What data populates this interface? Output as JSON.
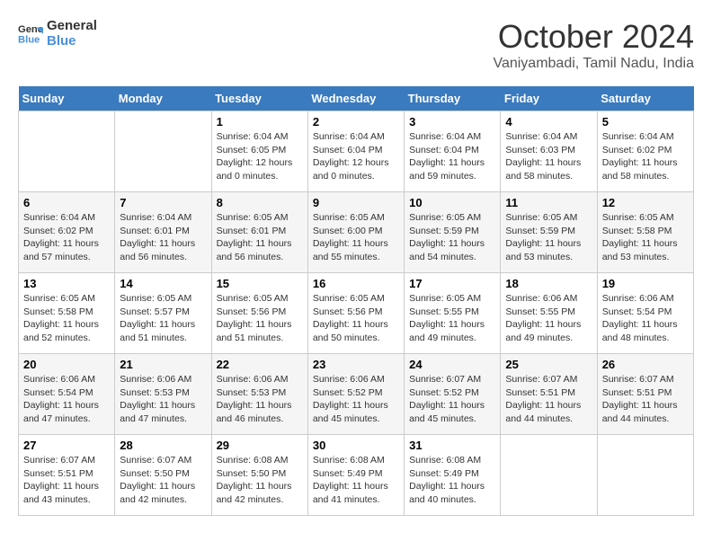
{
  "logo": {
    "line1": "General",
    "line2": "Blue"
  },
  "title": "October 2024",
  "subtitle": "Vaniyambadi, Tamil Nadu, India",
  "headers": [
    "Sunday",
    "Monday",
    "Tuesday",
    "Wednesday",
    "Thursday",
    "Friday",
    "Saturday"
  ],
  "weeks": [
    [
      {
        "day": "",
        "info": ""
      },
      {
        "day": "",
        "info": ""
      },
      {
        "day": "1",
        "info": "Sunrise: 6:04 AM\nSunset: 6:05 PM\nDaylight: 12 hours\nand 0 minutes."
      },
      {
        "day": "2",
        "info": "Sunrise: 6:04 AM\nSunset: 6:04 PM\nDaylight: 12 hours\nand 0 minutes."
      },
      {
        "day": "3",
        "info": "Sunrise: 6:04 AM\nSunset: 6:04 PM\nDaylight: 11 hours\nand 59 minutes."
      },
      {
        "day": "4",
        "info": "Sunrise: 6:04 AM\nSunset: 6:03 PM\nDaylight: 11 hours\nand 58 minutes."
      },
      {
        "day": "5",
        "info": "Sunrise: 6:04 AM\nSunset: 6:02 PM\nDaylight: 11 hours\nand 58 minutes."
      }
    ],
    [
      {
        "day": "6",
        "info": "Sunrise: 6:04 AM\nSunset: 6:02 PM\nDaylight: 11 hours\nand 57 minutes."
      },
      {
        "day": "7",
        "info": "Sunrise: 6:04 AM\nSunset: 6:01 PM\nDaylight: 11 hours\nand 56 minutes."
      },
      {
        "day": "8",
        "info": "Sunrise: 6:05 AM\nSunset: 6:01 PM\nDaylight: 11 hours\nand 56 minutes."
      },
      {
        "day": "9",
        "info": "Sunrise: 6:05 AM\nSunset: 6:00 PM\nDaylight: 11 hours\nand 55 minutes."
      },
      {
        "day": "10",
        "info": "Sunrise: 6:05 AM\nSunset: 5:59 PM\nDaylight: 11 hours\nand 54 minutes."
      },
      {
        "day": "11",
        "info": "Sunrise: 6:05 AM\nSunset: 5:59 PM\nDaylight: 11 hours\nand 53 minutes."
      },
      {
        "day": "12",
        "info": "Sunrise: 6:05 AM\nSunset: 5:58 PM\nDaylight: 11 hours\nand 53 minutes."
      }
    ],
    [
      {
        "day": "13",
        "info": "Sunrise: 6:05 AM\nSunset: 5:58 PM\nDaylight: 11 hours\nand 52 minutes."
      },
      {
        "day": "14",
        "info": "Sunrise: 6:05 AM\nSunset: 5:57 PM\nDaylight: 11 hours\nand 51 minutes."
      },
      {
        "day": "15",
        "info": "Sunrise: 6:05 AM\nSunset: 5:56 PM\nDaylight: 11 hours\nand 51 minutes."
      },
      {
        "day": "16",
        "info": "Sunrise: 6:05 AM\nSunset: 5:56 PM\nDaylight: 11 hours\nand 50 minutes."
      },
      {
        "day": "17",
        "info": "Sunrise: 6:05 AM\nSunset: 5:55 PM\nDaylight: 11 hours\nand 49 minutes."
      },
      {
        "day": "18",
        "info": "Sunrise: 6:06 AM\nSunset: 5:55 PM\nDaylight: 11 hours\nand 49 minutes."
      },
      {
        "day": "19",
        "info": "Sunrise: 6:06 AM\nSunset: 5:54 PM\nDaylight: 11 hours\nand 48 minutes."
      }
    ],
    [
      {
        "day": "20",
        "info": "Sunrise: 6:06 AM\nSunset: 5:54 PM\nDaylight: 11 hours\nand 47 minutes."
      },
      {
        "day": "21",
        "info": "Sunrise: 6:06 AM\nSunset: 5:53 PM\nDaylight: 11 hours\nand 47 minutes."
      },
      {
        "day": "22",
        "info": "Sunrise: 6:06 AM\nSunset: 5:53 PM\nDaylight: 11 hours\nand 46 minutes."
      },
      {
        "day": "23",
        "info": "Sunrise: 6:06 AM\nSunset: 5:52 PM\nDaylight: 11 hours\nand 45 minutes."
      },
      {
        "day": "24",
        "info": "Sunrise: 6:07 AM\nSunset: 5:52 PM\nDaylight: 11 hours\nand 45 minutes."
      },
      {
        "day": "25",
        "info": "Sunrise: 6:07 AM\nSunset: 5:51 PM\nDaylight: 11 hours\nand 44 minutes."
      },
      {
        "day": "26",
        "info": "Sunrise: 6:07 AM\nSunset: 5:51 PM\nDaylight: 11 hours\nand 44 minutes."
      }
    ],
    [
      {
        "day": "27",
        "info": "Sunrise: 6:07 AM\nSunset: 5:51 PM\nDaylight: 11 hours\nand 43 minutes."
      },
      {
        "day": "28",
        "info": "Sunrise: 6:07 AM\nSunset: 5:50 PM\nDaylight: 11 hours\nand 42 minutes."
      },
      {
        "day": "29",
        "info": "Sunrise: 6:08 AM\nSunset: 5:50 PM\nDaylight: 11 hours\nand 42 minutes."
      },
      {
        "day": "30",
        "info": "Sunrise: 6:08 AM\nSunset: 5:49 PM\nDaylight: 11 hours\nand 41 minutes."
      },
      {
        "day": "31",
        "info": "Sunrise: 6:08 AM\nSunset: 5:49 PM\nDaylight: 11 hours\nand 40 minutes."
      },
      {
        "day": "",
        "info": ""
      },
      {
        "day": "",
        "info": ""
      }
    ]
  ]
}
